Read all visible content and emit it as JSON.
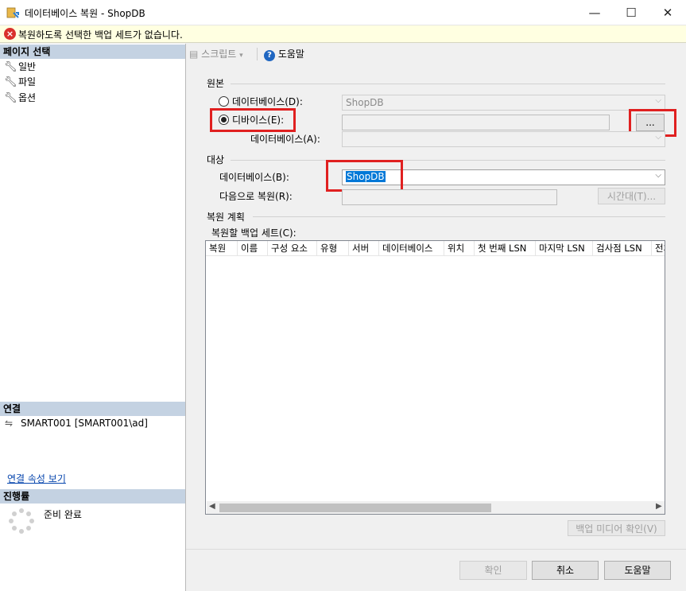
{
  "window": {
    "title": "데이터베이스 복원 - ShopDB",
    "controls": {
      "minimize": "—",
      "maximize": "☐",
      "close": "✕"
    }
  },
  "error_bar": {
    "text": "복원하도록 선택한 백업 세트가 없습니다."
  },
  "left_pane": {
    "page_select_header": "페이지 선택",
    "pages": [
      {
        "label": "일반",
        "icon": "wrench-icon"
      },
      {
        "label": "파일",
        "icon": "wrench-icon"
      },
      {
        "label": "옵션",
        "icon": "wrench-icon"
      }
    ],
    "connection_header": "연결",
    "connection_text": "SMART001 [SMART001\\ad]",
    "connection_link": "연결 속성 보기",
    "progress_header": "진행률",
    "progress_text": "준비 완료"
  },
  "toolbar": {
    "script_label": "스크립트",
    "help_label": "도움말"
  },
  "source": {
    "group_title": "원본",
    "database_option_label": "데이터베이스(D):",
    "database_value": "ShopDB",
    "device_option_label": "디바이스(E):",
    "device_value": "",
    "browse_label": "...",
    "device_database_label": "데이터베이스(A):",
    "device_database_value": "",
    "selected_option": "device"
  },
  "destination": {
    "group_title": "대상",
    "database_label": "데이터베이스(B):",
    "database_value": "ShopDB",
    "restore_to_label": "다음으로 복원(R):",
    "restore_to_value": "",
    "timeline_label": "시간대(T)..."
  },
  "restore_plan": {
    "group_title": "복원 계획",
    "backup_sets_label": "복원할 백업 세트(C):",
    "columns": [
      "복원",
      "이름",
      "구성 요소",
      "유형",
      "서버",
      "데이터베이스",
      "위치",
      "첫 번째 LSN",
      "마지막 LSN",
      "검사점 LSN",
      "전체"
    ],
    "verify_label": "백업 미디어 확인(V)"
  },
  "footer": {
    "ok_label": "확인",
    "cancel_label": "취소",
    "help_label": "도움말"
  },
  "colors": {
    "highlight": "#0078d7",
    "annotation": "#e02020",
    "section_header": "#c4d2e2",
    "error_bg": "#ffffe1"
  }
}
